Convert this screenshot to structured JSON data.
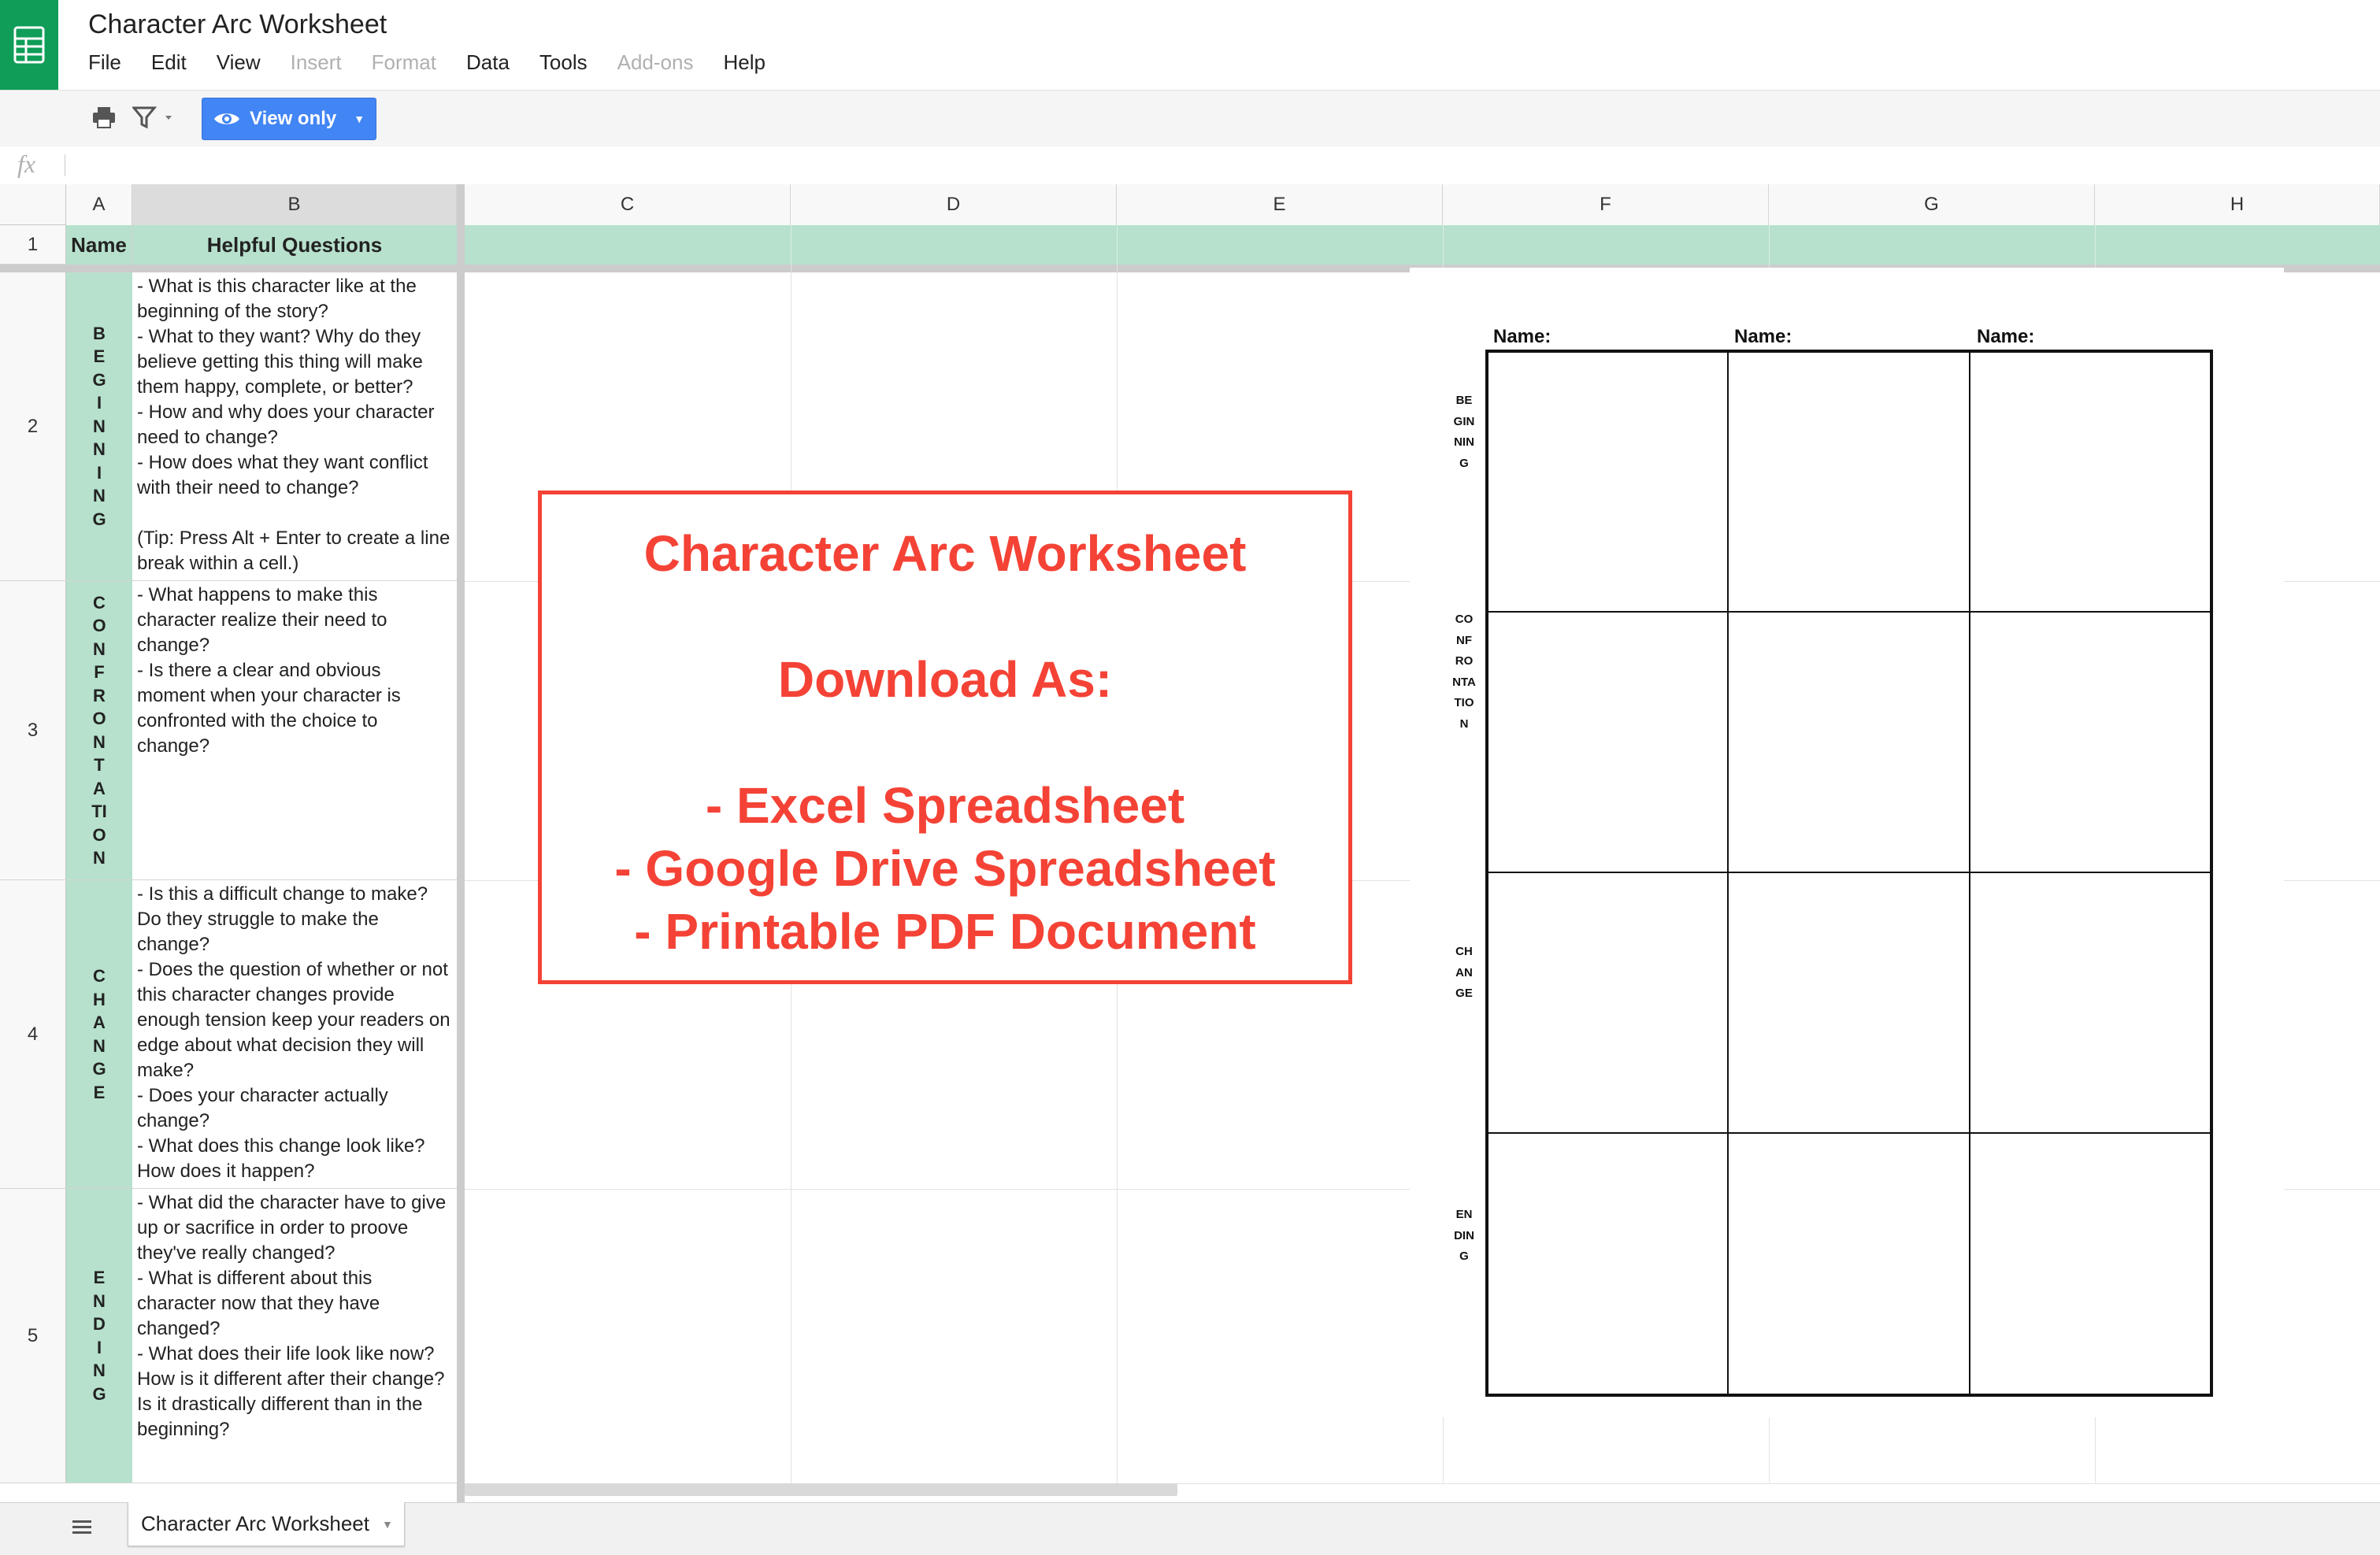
{
  "app": {
    "title": "Character Arc Worksheet"
  },
  "menu": [
    "File",
    "Edit",
    "View",
    "Insert",
    "Format",
    "Data",
    "Tools",
    "Add-ons",
    "Help"
  ],
  "menu_disabled": [
    "Insert",
    "Format",
    "Add-ons"
  ],
  "toolbar": {
    "view_only_label": "View only"
  },
  "formula_bar": {
    "fx_label": "fx",
    "value": ""
  },
  "columns": [
    "A",
    "B",
    "C",
    "D",
    "E",
    "F",
    "G",
    "H"
  ],
  "rows": [
    "1",
    "2",
    "3",
    "4",
    "5"
  ],
  "header_row": {
    "name": "Name",
    "questions": "Helpful Questions"
  },
  "stages": [
    {
      "label": "BEGINNING",
      "questions": "- What is this character like at the beginning of the story?\n- What to they want? Why do they believe getting this thing will make them happy, complete, or better?\n- How and why does your character need to change?\n- How does what they want conflict with their need to change?\n\n(Tip: Press Alt + Enter to create a line break within a cell.)"
    },
    {
      "label": "CONFRONTATION",
      "questions": "- What happens to make this character realize their need to change?\n- Is there a clear and obvious moment when your character is confronted with the choice to change?"
    },
    {
      "label": "CHANGE",
      "questions": "- Is this a difficult change to make? Do they struggle to make the change?\n- Does the question of whether or not this character changes provide enough tension keep your readers on edge about what decision they will make?\n- Does your character actually change?\n- What does this change look like? How does it happen?"
    },
    {
      "label": "ENDING",
      "questions": "- What did the character have to give up or sacrifice in order to proove they've really changed?\n- What is different about this character now that they have changed?\n- What does their life look like now? How is it different after their change? Is it drastically different than in the beginning?"
    }
  ],
  "promo": {
    "title": "Character Arc Worksheet",
    "subtitle": "Download As:",
    "options": [
      "- Excel Spreadsheet",
      "- Google Drive Spreadsheet",
      "- Printable PDF Document"
    ]
  },
  "preview": {
    "name_labels": [
      "Name:",
      "Name:",
      "Name:"
    ],
    "stage_labels": [
      "BEGINNING",
      "CONFRONTATION",
      "CHANGE",
      "ENDING"
    ]
  },
  "sheet_tab": {
    "label": "Character Arc Worksheet"
  },
  "colors": {
    "green": "#0f9d58",
    "header_fill": "#b7e1cd",
    "accent_blue": "#4285f4",
    "promo_red": "#f44336"
  }
}
